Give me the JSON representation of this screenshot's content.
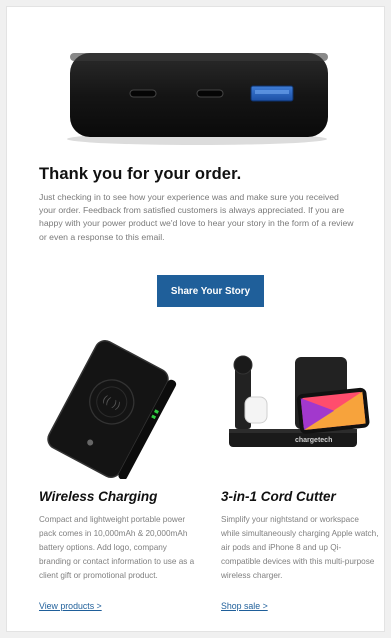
{
  "email": {
    "heading": "Thank you for your order.",
    "intro": "Just checking in to see how your experience was and make sure you received your order. Feedback from satisfied customers is always appreciated. If you are happy with your power product we'd love to hear your story in the form of a review or even a response to this email.",
    "cta_label": "Share Your Story"
  },
  "products": [
    {
      "title": "Wireless Charging",
      "description": "Compact and lightweight portable power pack comes in 10,000mAh & 20,000mAh battery options. Add logo, company branding or contact information to use as a client gift or promotional product.",
      "link_label": "View products >"
    },
    {
      "title": "3-in-1 Cord Cutter",
      "description": "Simplify your nightstand or workspace while simultaneously charging Apple watch, air pods and iPhone 8 and up Qi-compatible devices with this multi-purpose wireless charger.",
      "link_label": "Shop sale >",
      "brand_text": "chargetech"
    }
  ],
  "colors": {
    "accent": "#1f5f9a",
    "heading": "#111111",
    "body_text": "#7a7a7a"
  }
}
